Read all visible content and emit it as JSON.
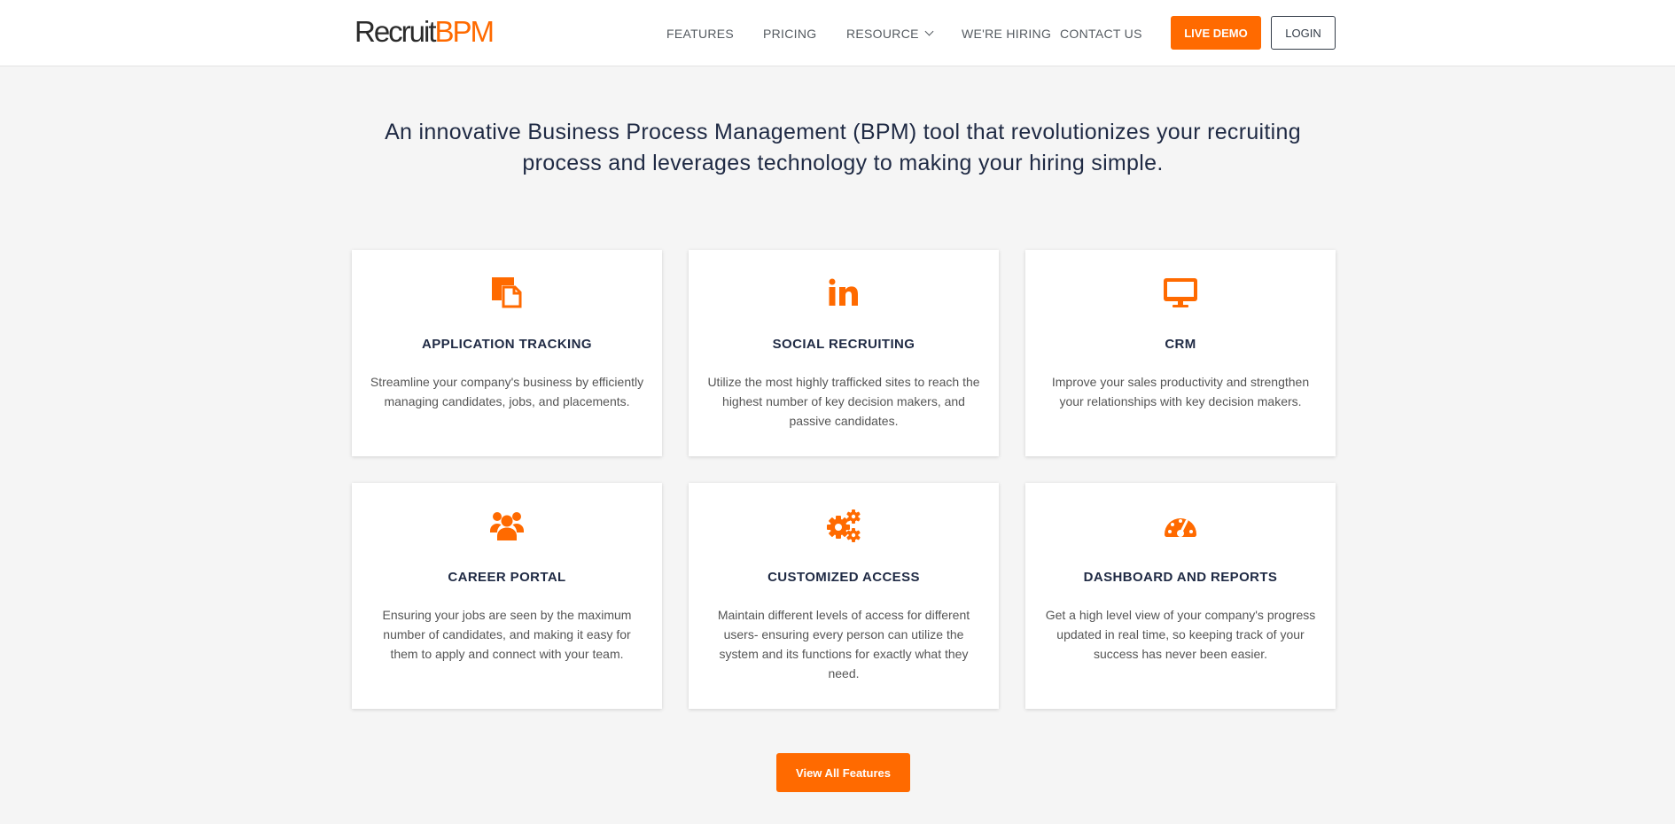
{
  "header": {
    "logo_part1": "Recruit",
    "logo_part2": "BPM",
    "nav": {
      "features": "FEATURES",
      "pricing": "PRICING",
      "resource": "RESOURCE",
      "hiring": "WE'RE HIRING",
      "contact": "CONTACT US"
    },
    "live_demo": "LIVE DEMO",
    "login": "LOGIN"
  },
  "hero": {
    "line1": "An innovative Business Process Management (BPM) tool that revolutionizes your recruiting",
    "line2": "process and leverages technology to making your hiring simple."
  },
  "features": [
    {
      "icon": "documents-icon",
      "title": "APPLICATION TRACKING",
      "desc": "Streamline your company's business by efficiently managing candidates, jobs, and placements."
    },
    {
      "icon": "linkedin-icon",
      "title": "SOCIAL RECRUITING",
      "desc": "Utilize the most highly trafficked sites to reach the highest number of key decision makers, and passive candidates."
    },
    {
      "icon": "desktop-icon",
      "title": "CRM",
      "desc": "Improve your sales productivity and strengthen your relationships with key decision makers."
    },
    {
      "icon": "users-icon",
      "title": "CAREER PORTAL",
      "desc": "Ensuring your jobs are seen by the maximum number of candidates, and making it easy for them to apply and connect with your team."
    },
    {
      "icon": "gears-icon",
      "title": "CUSTOMIZED ACCESS",
      "desc": "Maintain different levels of access for different users- ensuring every person can utilize the system and its functions for exactly what they need."
    },
    {
      "icon": "dashboard-icon",
      "title": "DASHBOARD AND REPORTS",
      "desc": "Get a high level view of your company's progress updated in real time, so keeping track of your success has never been easier."
    }
  ],
  "view_all_label": "View All Features",
  "colors": {
    "accent": "#ff6a00",
    "navy": "#1f2a44"
  }
}
